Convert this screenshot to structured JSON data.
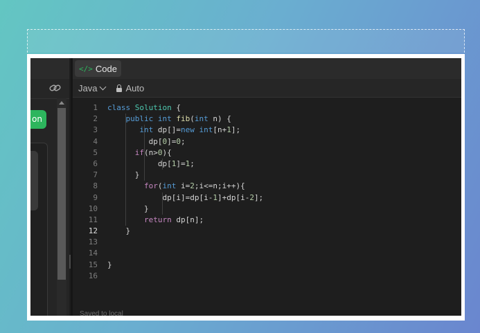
{
  "left_panel": {
    "link_icon": "link-icon",
    "green_button_label": "on"
  },
  "editor": {
    "tab": {
      "icon": "code-brackets-icon",
      "icon_glyph": "</>",
      "label": "Code"
    },
    "toolbar": {
      "language": "Java",
      "language_icon": "chevron-down-icon",
      "mode_icon": "lock-icon",
      "mode": "Auto"
    },
    "active_line": 12,
    "line_numbers": [
      "1",
      "2",
      "3",
      "4",
      "5",
      "6",
      "7",
      "8",
      "9",
      "10",
      "11",
      "12",
      "13",
      "14",
      "15",
      "16"
    ],
    "code_lines": [
      "class Solution {",
      "    public int fib(int n) {",
      "       int dp[]=new int[n+1];",
      "         dp[0]=0;",
      "      if(n>0){",
      "           dp[1]=1;",
      "      }",
      "        for(int i=2;i<=n;i++){",
      "            dp[i]=dp[i-1]+dp[i-2];",
      "        }",
      "        return dp[n];",
      "    }",
      "",
      "",
      "}",
      ""
    ],
    "footer_status": "Saved to local"
  },
  "colors": {
    "accent_green": "#2db55d",
    "editor_bg": "#1e1e1e",
    "keyword": "#569cd6",
    "control_keyword": "#c586c0",
    "type": "#4ec9b0",
    "function": "#dcdcaa",
    "number": "#b5cea8"
  }
}
